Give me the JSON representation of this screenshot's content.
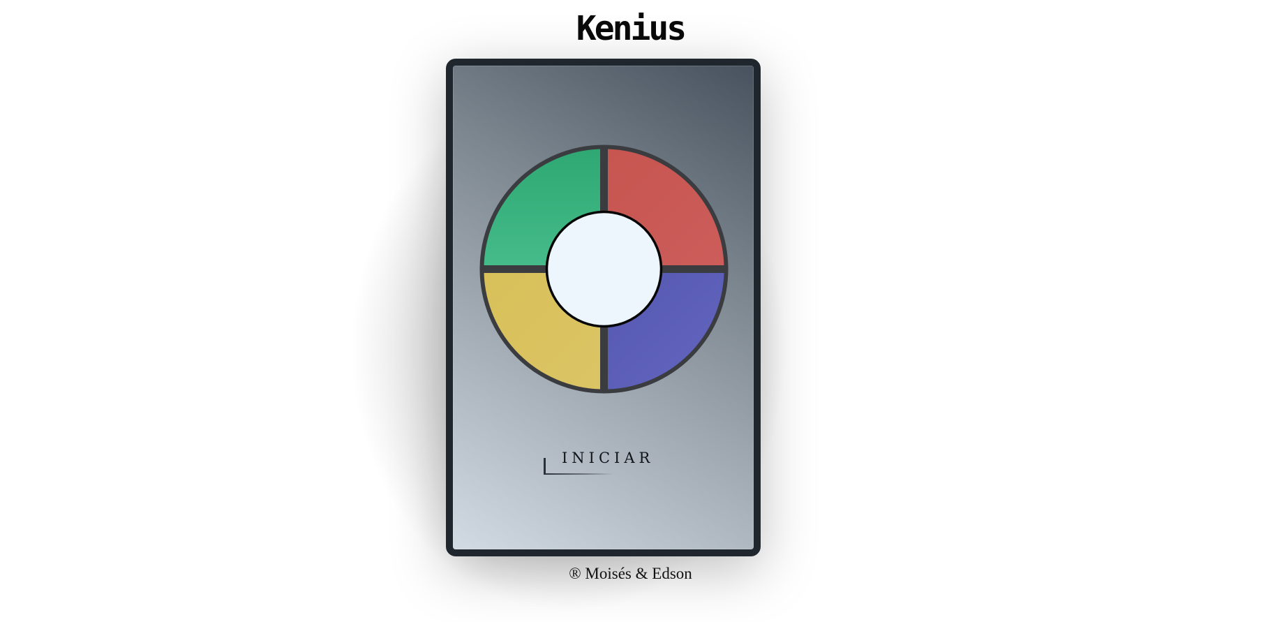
{
  "header": {
    "title": "Kenius"
  },
  "game": {
    "pads": [
      {
        "id": "green",
        "color": "#37b07e"
      },
      {
        "id": "red",
        "color": "#c95754"
      },
      {
        "id": "yellow",
        "color": "#d9c15e"
      },
      {
        "id": "blue",
        "color": "#5c5fb6"
      }
    ],
    "center_color": "#eef6fd",
    "divider_color": "#3a3c40",
    "start_label": "INICIAR"
  },
  "footer": {
    "credit": "® Moisés & Edson"
  },
  "colors": {
    "frame": "#1f262d",
    "background": "#ffffff"
  }
}
